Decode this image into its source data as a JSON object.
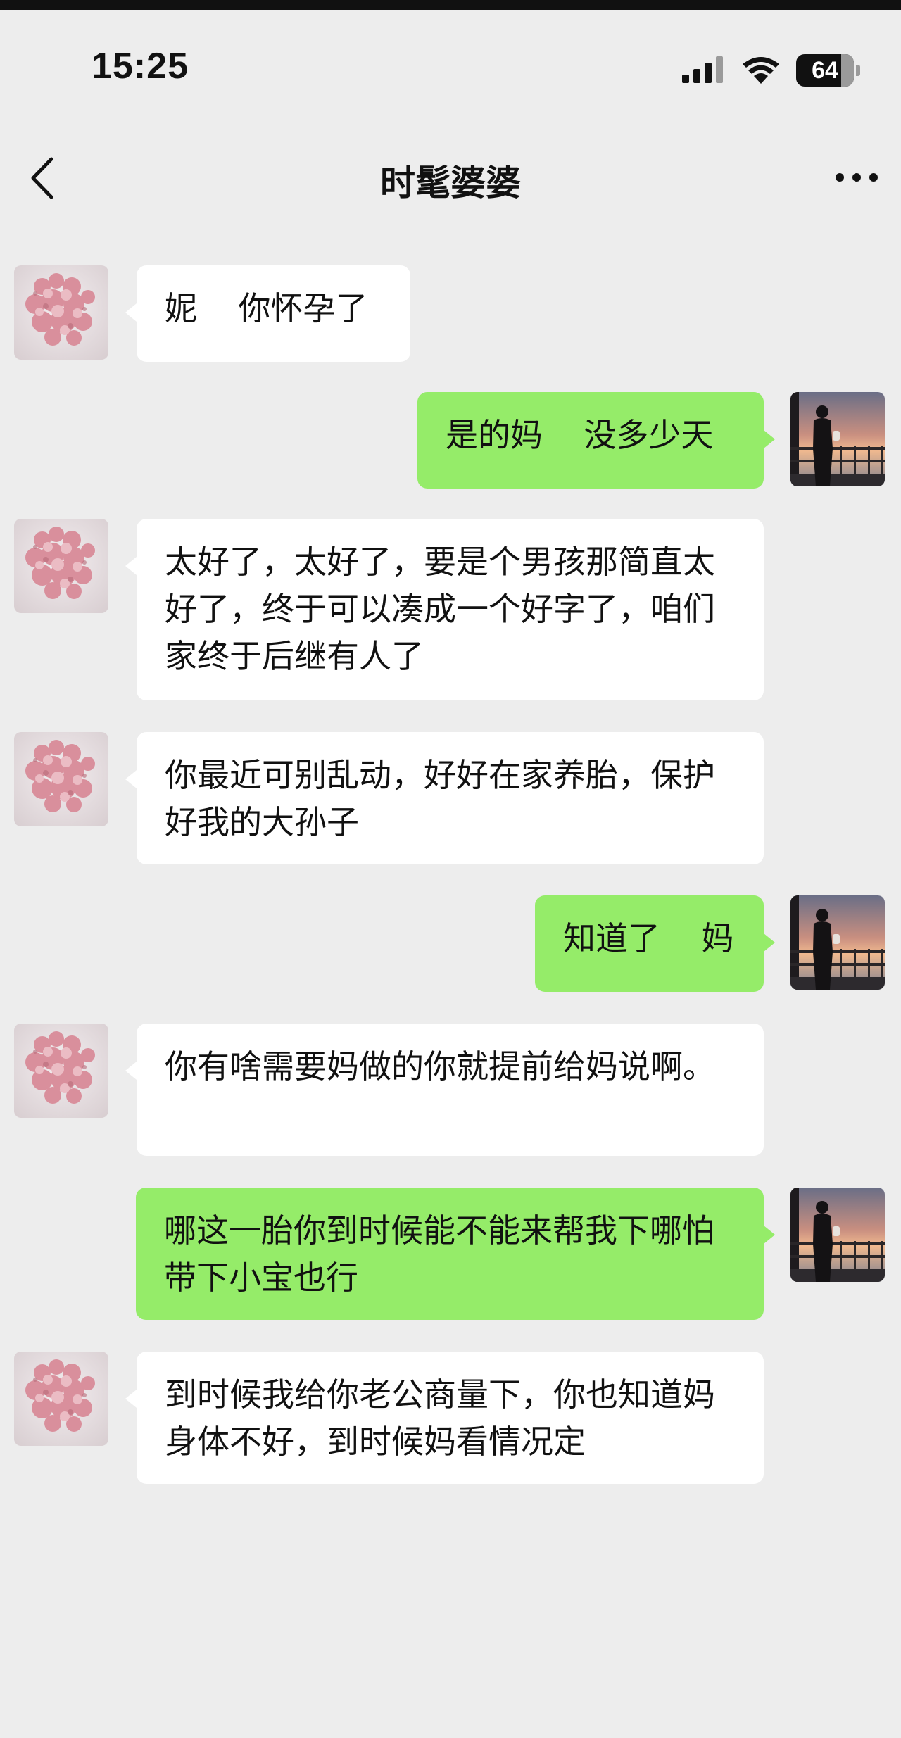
{
  "status_bar": {
    "time": "15:25",
    "battery": "64"
  },
  "nav": {
    "title": "时髦婆婆"
  },
  "icons": {
    "back": "chevron-left-icon",
    "more": "more-dots-icon",
    "signal": "signal-icon",
    "wifi": "wifi-icon",
    "battery": "battery-icon"
  },
  "colors": {
    "background": "#ededed",
    "outgoing_bubble": "#95ec69",
    "incoming_bubble": "#ffffff"
  },
  "messages": [
    {
      "from": "contact",
      "text": "妮    你怀孕了"
    },
    {
      "from": "me",
      "text": "是的妈    没多少天"
    },
    {
      "from": "contact",
      "text": "太好了，太好了，要是个男孩那简直太好了，终于可以凑成一个好字了，咱们家终于后继有人了"
    },
    {
      "from": "contact",
      "text": "你最近可别乱动，好好在家养胎，保护好我的大孙子"
    },
    {
      "from": "me",
      "text": "知道了    妈"
    },
    {
      "from": "contact",
      "text": "你有啥需要妈做的你就提前给妈说啊。"
    },
    {
      "from": "me",
      "text": "哪这一胎你到时候能不能来帮我下哪怕带下小宝也行"
    },
    {
      "from": "contact",
      "text": "到时候我给你老公商量下，你也知道妈身体不好，到时候妈看情况定"
    }
  ]
}
